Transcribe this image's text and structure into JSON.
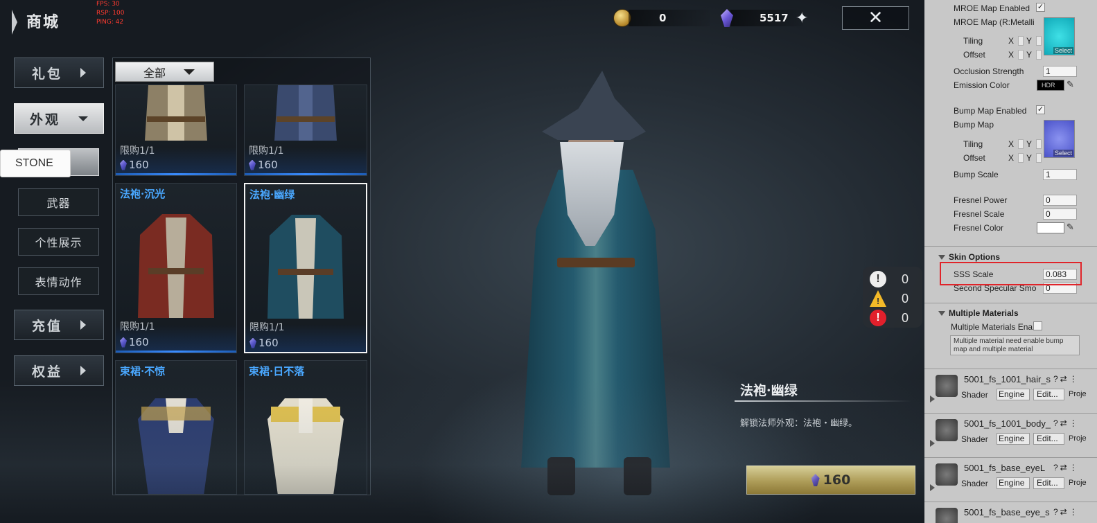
{
  "game": {
    "title": "商城",
    "stats": {
      "fps": "FPS: 30",
      "rsp": "RSP: 100",
      "ping": "PING: 42"
    },
    "currency": {
      "coins": "0",
      "gems": "5517"
    },
    "nav": [
      {
        "label": "礼包",
        "state": "collapsed"
      },
      {
        "label": "外观",
        "state": "expanded"
      },
      {
        "label": "充值",
        "state": "collapsed"
      },
      {
        "label": "权益",
        "state": "collapsed"
      }
    ],
    "sub_nav": [
      "武器",
      "个性展示",
      "表情动作"
    ],
    "tooltip": "STONE",
    "filter": "全部",
    "items": [
      {
        "name": "",
        "limit": "限购1/1",
        "price": "160"
      },
      {
        "name": "",
        "limit": "限购1/1",
        "price": "160"
      },
      {
        "name": "法袍·沉光",
        "limit": "限购1/1",
        "price": "160"
      },
      {
        "name": "法袍·幽绿",
        "limit": "限购1/1",
        "price": "160"
      },
      {
        "name": "束裙·不惊",
        "limit": "",
        "price": ""
      },
      {
        "name": "束裙·日不落",
        "limit": "",
        "price": ""
      }
    ],
    "console_counts": {
      "info": "0",
      "warning": "0",
      "error": "0"
    },
    "detail": {
      "title": "法袍·幽绿",
      "description": "解锁法师外观：法袍・幽绿。",
      "price": "160"
    }
  },
  "inspector": {
    "mroe_enabled": "MROE Map Enabled",
    "mroe_map": "MROE Map (R:Metalli",
    "tiling": "Tiling",
    "offset": "Offset",
    "x": "X",
    "y": "Y",
    "select": "Select",
    "occlusion_label": "Occlusion Strength",
    "occlusion_value": "1",
    "emission_label": "Emission Color",
    "hdr": "HDR",
    "bump_enabled": "Bump Map Enabled",
    "bump_map": "Bump Map",
    "bump_scale_label": "Bump Scale",
    "bump_scale_value": "1",
    "fresnel_power_label": "Fresnel Power",
    "fresnel_power_value": "0",
    "fresnel_scale_label": "Fresnel Scale",
    "fresnel_scale_value": "0",
    "fresnel_color_label": "Fresnel Color",
    "skin_options": "Skin Options",
    "sss_scale_label": "SSS Scale",
    "sss_scale_value": "0.083",
    "second_spec_label": "Second Specular Smo",
    "second_spec_value": "0",
    "multiple_materials": "Multiple Materials",
    "multiple_materials_enable": "Multiple Materials Ena",
    "help_text": "Multiple material need enable bump map and multiple material",
    "materials": [
      {
        "name": "5001_fs_1001_hair_s",
        "shader": "Shader",
        "shader_value": "Engine",
        "edit": "Edit...",
        "proj": "Proje"
      },
      {
        "name": "5001_fs_1001_body_",
        "shader": "Shader",
        "shader_value": "Engine",
        "edit": "Edit...",
        "proj": "Proje"
      },
      {
        "name": "5001_fs_base_eyeL",
        "shader": "Shader",
        "shader_value": "Engine",
        "edit": "Edit...",
        "proj": "Proje"
      },
      {
        "name": "5001_fs_base_eye_s",
        "shader": "",
        "shader_value": "",
        "edit": "",
        "proj": ""
      }
    ],
    "colors": {
      "mroe_tex": "#18c8d4",
      "bump_tex": "#5b63d8",
      "emission": "#000000",
      "fresnel": "#ffffff",
      "highlight": "#e0242a"
    }
  }
}
